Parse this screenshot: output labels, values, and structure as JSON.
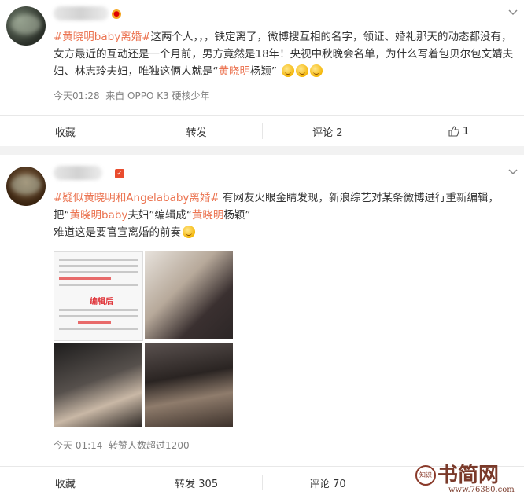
{
  "post1": {
    "hashtag": "#黄晓明baby离婚#",
    "body_part1": "这两个人，，，铁定离了，微博搜互相的名字，领证、婚礼那天的动态都没有，女方最近的互动还是一个月前，男方竟然是18年！央视中秋晚会名单，为什么写着包贝尔包文婧夫妇、林志玲夫妇，唯独这俩人就是“",
    "highlight": "黄晓明",
    "body_part2": "杨颖”",
    "meta_time": "今天01:28",
    "meta_source": "来自 OPPO K3 硬核少年",
    "actions": {
      "favorite": "收藏",
      "repost": "转发",
      "comment": "评论 2",
      "like": "1"
    }
  },
  "post2": {
    "hashtag_prefix": "#疑似",
    "hashtag_hl1": "黄晓明",
    "hashtag_mid": "和Angela",
    "hashtag_hl2": "baby离婚",
    "hashtag_suffix": "#",
    "line1_text": " 有网友火眼金睛发现，新浪综艺对某条微博进行重新编辑，",
    "line2_pre": "把“",
    "line2_hl1": "黄晓明baby",
    "line2_mid": "夫妇”编辑成“",
    "line2_hl2": "黄晓明",
    "line2_post": "杨颖”",
    "line3": "难道这是要官宣离婚的前奏",
    "image_label": "编辑后",
    "meta_time": "今天 01:14",
    "meta_extra": "转赞人数超过1200",
    "actions": {
      "favorite": "收藏",
      "repost": "转发 305",
      "comment": "评论 70"
    }
  },
  "watermark": {
    "text": "书简网",
    "url": "www.76380.com",
    "seal": "知识"
  }
}
